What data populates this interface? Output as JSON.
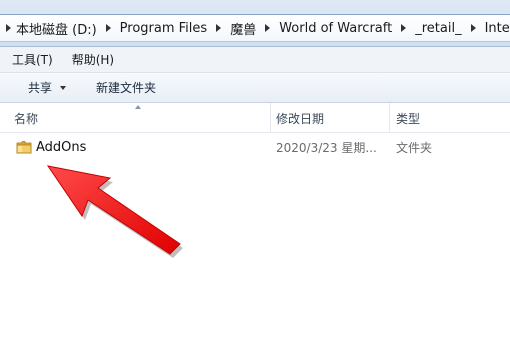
{
  "address": {
    "crumbs": [
      "本地磁盘 (D:)",
      "Program Files",
      "魔兽",
      "World of Warcraft",
      "_retail_",
      "Interface"
    ]
  },
  "menu": {
    "tools": "工具(T)",
    "help": "帮助(H)"
  },
  "toolbar": {
    "share": "共享",
    "new_folder": "新建文件夹"
  },
  "columns": {
    "name": "名称",
    "date_modified": "修改日期",
    "type": "类型"
  },
  "files": [
    {
      "name": "AddOns",
      "date": "2020/3/23 星期...",
      "type": "文件夹"
    }
  ],
  "colors": {
    "annotation_arrow": "#ff1a1a",
    "folder": "#e8b94a"
  }
}
